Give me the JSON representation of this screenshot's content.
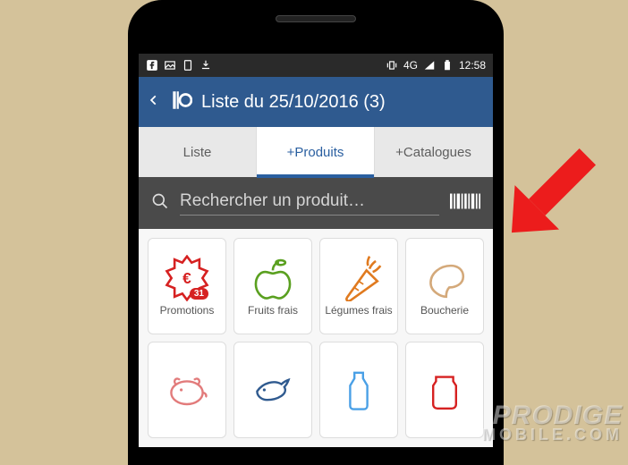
{
  "statusbar": {
    "network_label": "4G",
    "time": "12:58"
  },
  "header": {
    "title": "Liste du 25/10/2016 (3)"
  },
  "tabs": [
    {
      "label": "Liste",
      "active": false
    },
    {
      "label": "+Produits",
      "active": true
    },
    {
      "label": "+Catalogues",
      "active": false
    }
  ],
  "search": {
    "placeholder": "Rechercher un produit…"
  },
  "categories": [
    {
      "name": "promotions",
      "label": "Promotions",
      "badge": "31",
      "color": "#d62121"
    },
    {
      "name": "fruits-frais",
      "label": "Fruits frais",
      "color": "#5aa020"
    },
    {
      "name": "legumes-frais",
      "label": "Légumes frais",
      "color": "#e07a1f"
    },
    {
      "name": "boucherie",
      "label": "Boucherie",
      "color": "#d4a97a"
    }
  ],
  "categories_row2": [
    {
      "name": "charcuterie",
      "color": "#e27b7b"
    },
    {
      "name": "poissonnerie",
      "color": "#2f5a8f"
    },
    {
      "name": "produits-laitiers",
      "color": "#4aa0e6"
    },
    {
      "name": "divers",
      "color": "#d62121"
    }
  ],
  "watermark": {
    "line1": "PRODIGE",
    "line2": "MOBILE.COM"
  }
}
